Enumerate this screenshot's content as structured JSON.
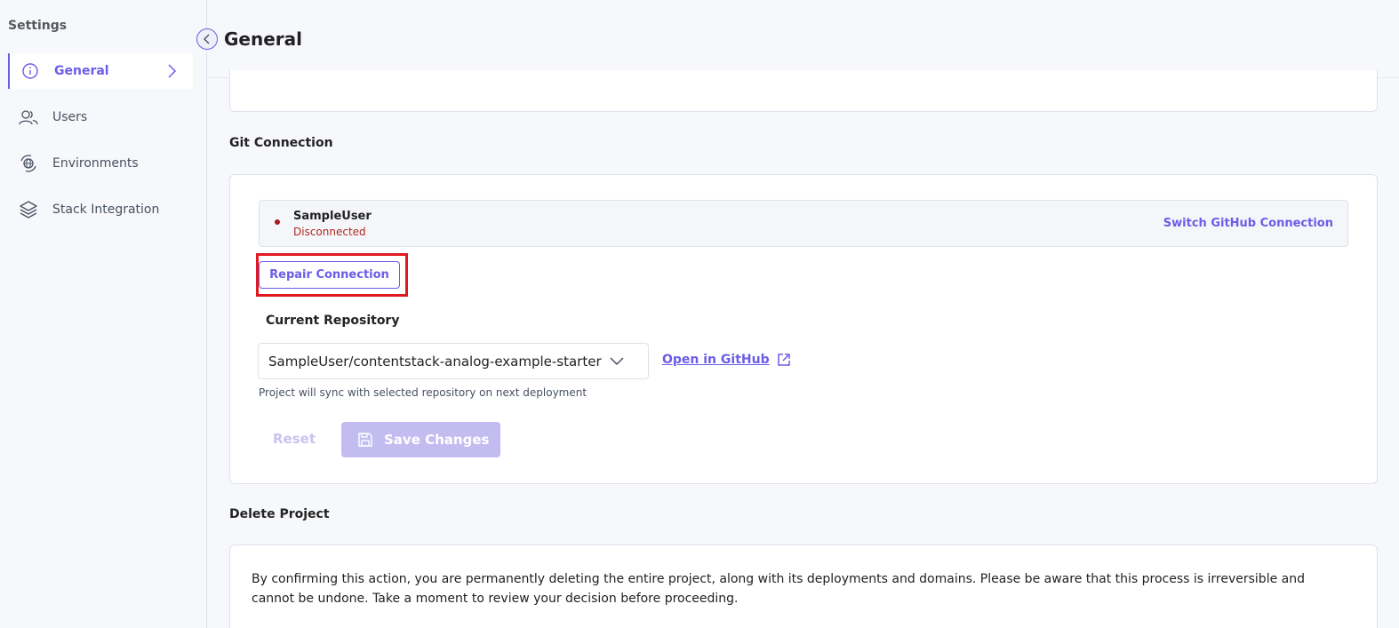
{
  "sidebar": {
    "title": "Settings",
    "items": [
      {
        "label": "General",
        "icon": "info-icon",
        "active": true
      },
      {
        "label": "Users",
        "icon": "users-icon"
      },
      {
        "label": "Environments",
        "icon": "environments-icon"
      },
      {
        "label": "Stack Integration",
        "icon": "layers-icon"
      }
    ]
  },
  "header": {
    "title": "General"
  },
  "git": {
    "section_label": "Git Connection",
    "user": "SampleUser",
    "status": "Disconnected",
    "switch_label": "Switch GitHub Connection",
    "repair_label": "Repair Connection",
    "repo_label": "Current Repository",
    "repo_value": "SampleUser/contentstack-analog-example-starter",
    "open_label": "Open in GitHub",
    "helper": "Project will sync with selected repository on next deployment",
    "reset_label": "Reset",
    "save_label": "Save Changes"
  },
  "delete": {
    "section_label": "Delete Project",
    "text": "By confirming this action, you are permanently deleting the entire project, along with its deployments and domains. Please be aware that this process is irreversible and cannot be undone. Take a moment to review your decision before proceeding."
  },
  "colors": {
    "accent": "#6c5ce7",
    "error": "#b0291e",
    "highlight": "#e0181f"
  }
}
